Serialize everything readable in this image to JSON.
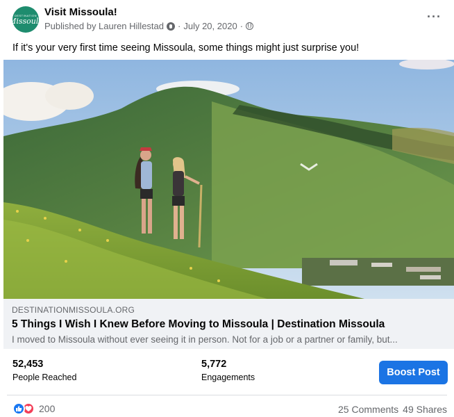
{
  "post": {
    "page_name": "Visit Missoula!",
    "avatar": {
      "small_text": "DESTINATION",
      "big_text": "Missoula",
      "color": "#1e8c6e"
    },
    "published_by": "Published by Lauren Hillestad",
    "separator": "·",
    "date": "July 20, 2020",
    "more_label": "···",
    "caption": "If it's your very first time seeing Missoula, some things might just surprise you!",
    "icons": {
      "author": "person-badge-icon",
      "audience": "globe-icon",
      "more": "more-horizontal-icon"
    }
  },
  "link_preview": {
    "domain": "DESTINATIONMISSOULA.ORG",
    "title": "5 Things I Wish I Knew Before Moving to Missoula | Destination Missoula",
    "description": "I moved to Missoula without ever seeing it in person. Not for a job or a partner or family, but..."
  },
  "insights": {
    "reach": {
      "value": "52,453",
      "label": "People Reached"
    },
    "engagements": {
      "value": "5,772",
      "label": "Engagements"
    },
    "boost_label": "Boost Post",
    "accent": "#1b74e4"
  },
  "footer": {
    "reactions_count": "200",
    "comments": "25 Comments",
    "shares": "49 Shares",
    "reaction_icons": [
      "like-icon",
      "love-icon"
    ]
  }
}
